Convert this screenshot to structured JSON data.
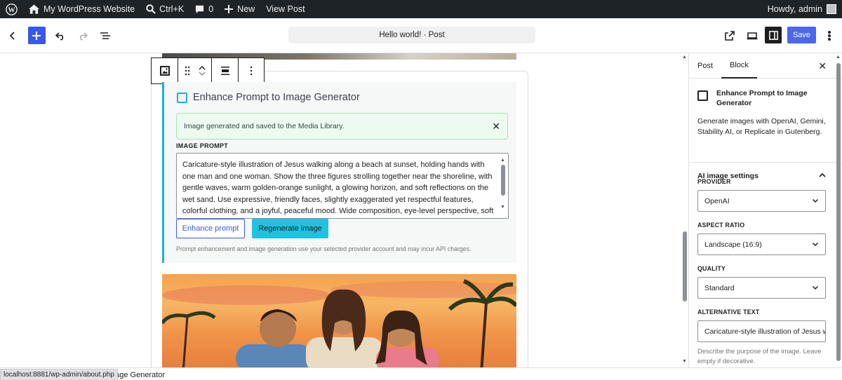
{
  "adminbar": {
    "site_name": "My WordPress Website",
    "search_shortcut": "Ctrl+K",
    "comments_count": "0",
    "new_label": "New",
    "view_post": "View Post",
    "greeting": "Howdy, admin"
  },
  "header": {
    "document_title": "Hello world! · Post",
    "save_label": "Save"
  },
  "block": {
    "title": "Enhance Prompt to Image Generator",
    "notice": "Image generated and saved to the Media Library.",
    "prompt_label": "IMAGE PROMPT",
    "prompt_text": "Caricature-style illustration of Jesus walking along a beach at sunset, holding hands with one man and one woman. Show the three figures strolling together near the shoreline, with gentle waves, warm golden-orange sunlight, a glowing horizon, and soft reflections on the wet sand. Use expressive, friendly faces, slightly exaggerated yet respectful features, colorful clothing, and a joyful, peaceful mood. Wide composition, eye-level perspective, soft atmospheric lighting, vibrant",
    "enhance_label": "Enhance prompt",
    "regenerate_label": "Regenerate image",
    "note": "Prompt enhancement and image generation use your selected provider account and may incur API charges."
  },
  "sidebar": {
    "tabs": [
      {
        "label": "Post"
      },
      {
        "label": "Block"
      }
    ],
    "block_name": "Enhance Prompt to Image Generator",
    "block_desc": "Generate images with OpenAI, Gemini, Stability AI, or Replicate in Gutenberg.",
    "panel_title": "AI image settings",
    "provider_label": "PROVIDER",
    "provider_value": "OpenAI",
    "aspect_label": "ASPECT RATIO",
    "aspect_value": "Landscape (16:9)",
    "quality_label": "QUALITY",
    "quality_value": "Standard",
    "alt_label": "ALTERNATIVE TEXT",
    "alt_value": "Caricature-style illustration of Jesus w",
    "alt_help": "Describe the purpose of the image. Leave empty if decorative."
  },
  "status": {
    "url": "localhost:8881/wp-admin/about.php",
    "breadcrumb": "nage Generator"
  },
  "colors": {
    "accent": "#3858e9",
    "block_accent": "#1fb0d3",
    "regenerate_bg": "#1fc3e0",
    "notice_bg": "#edfaef"
  }
}
